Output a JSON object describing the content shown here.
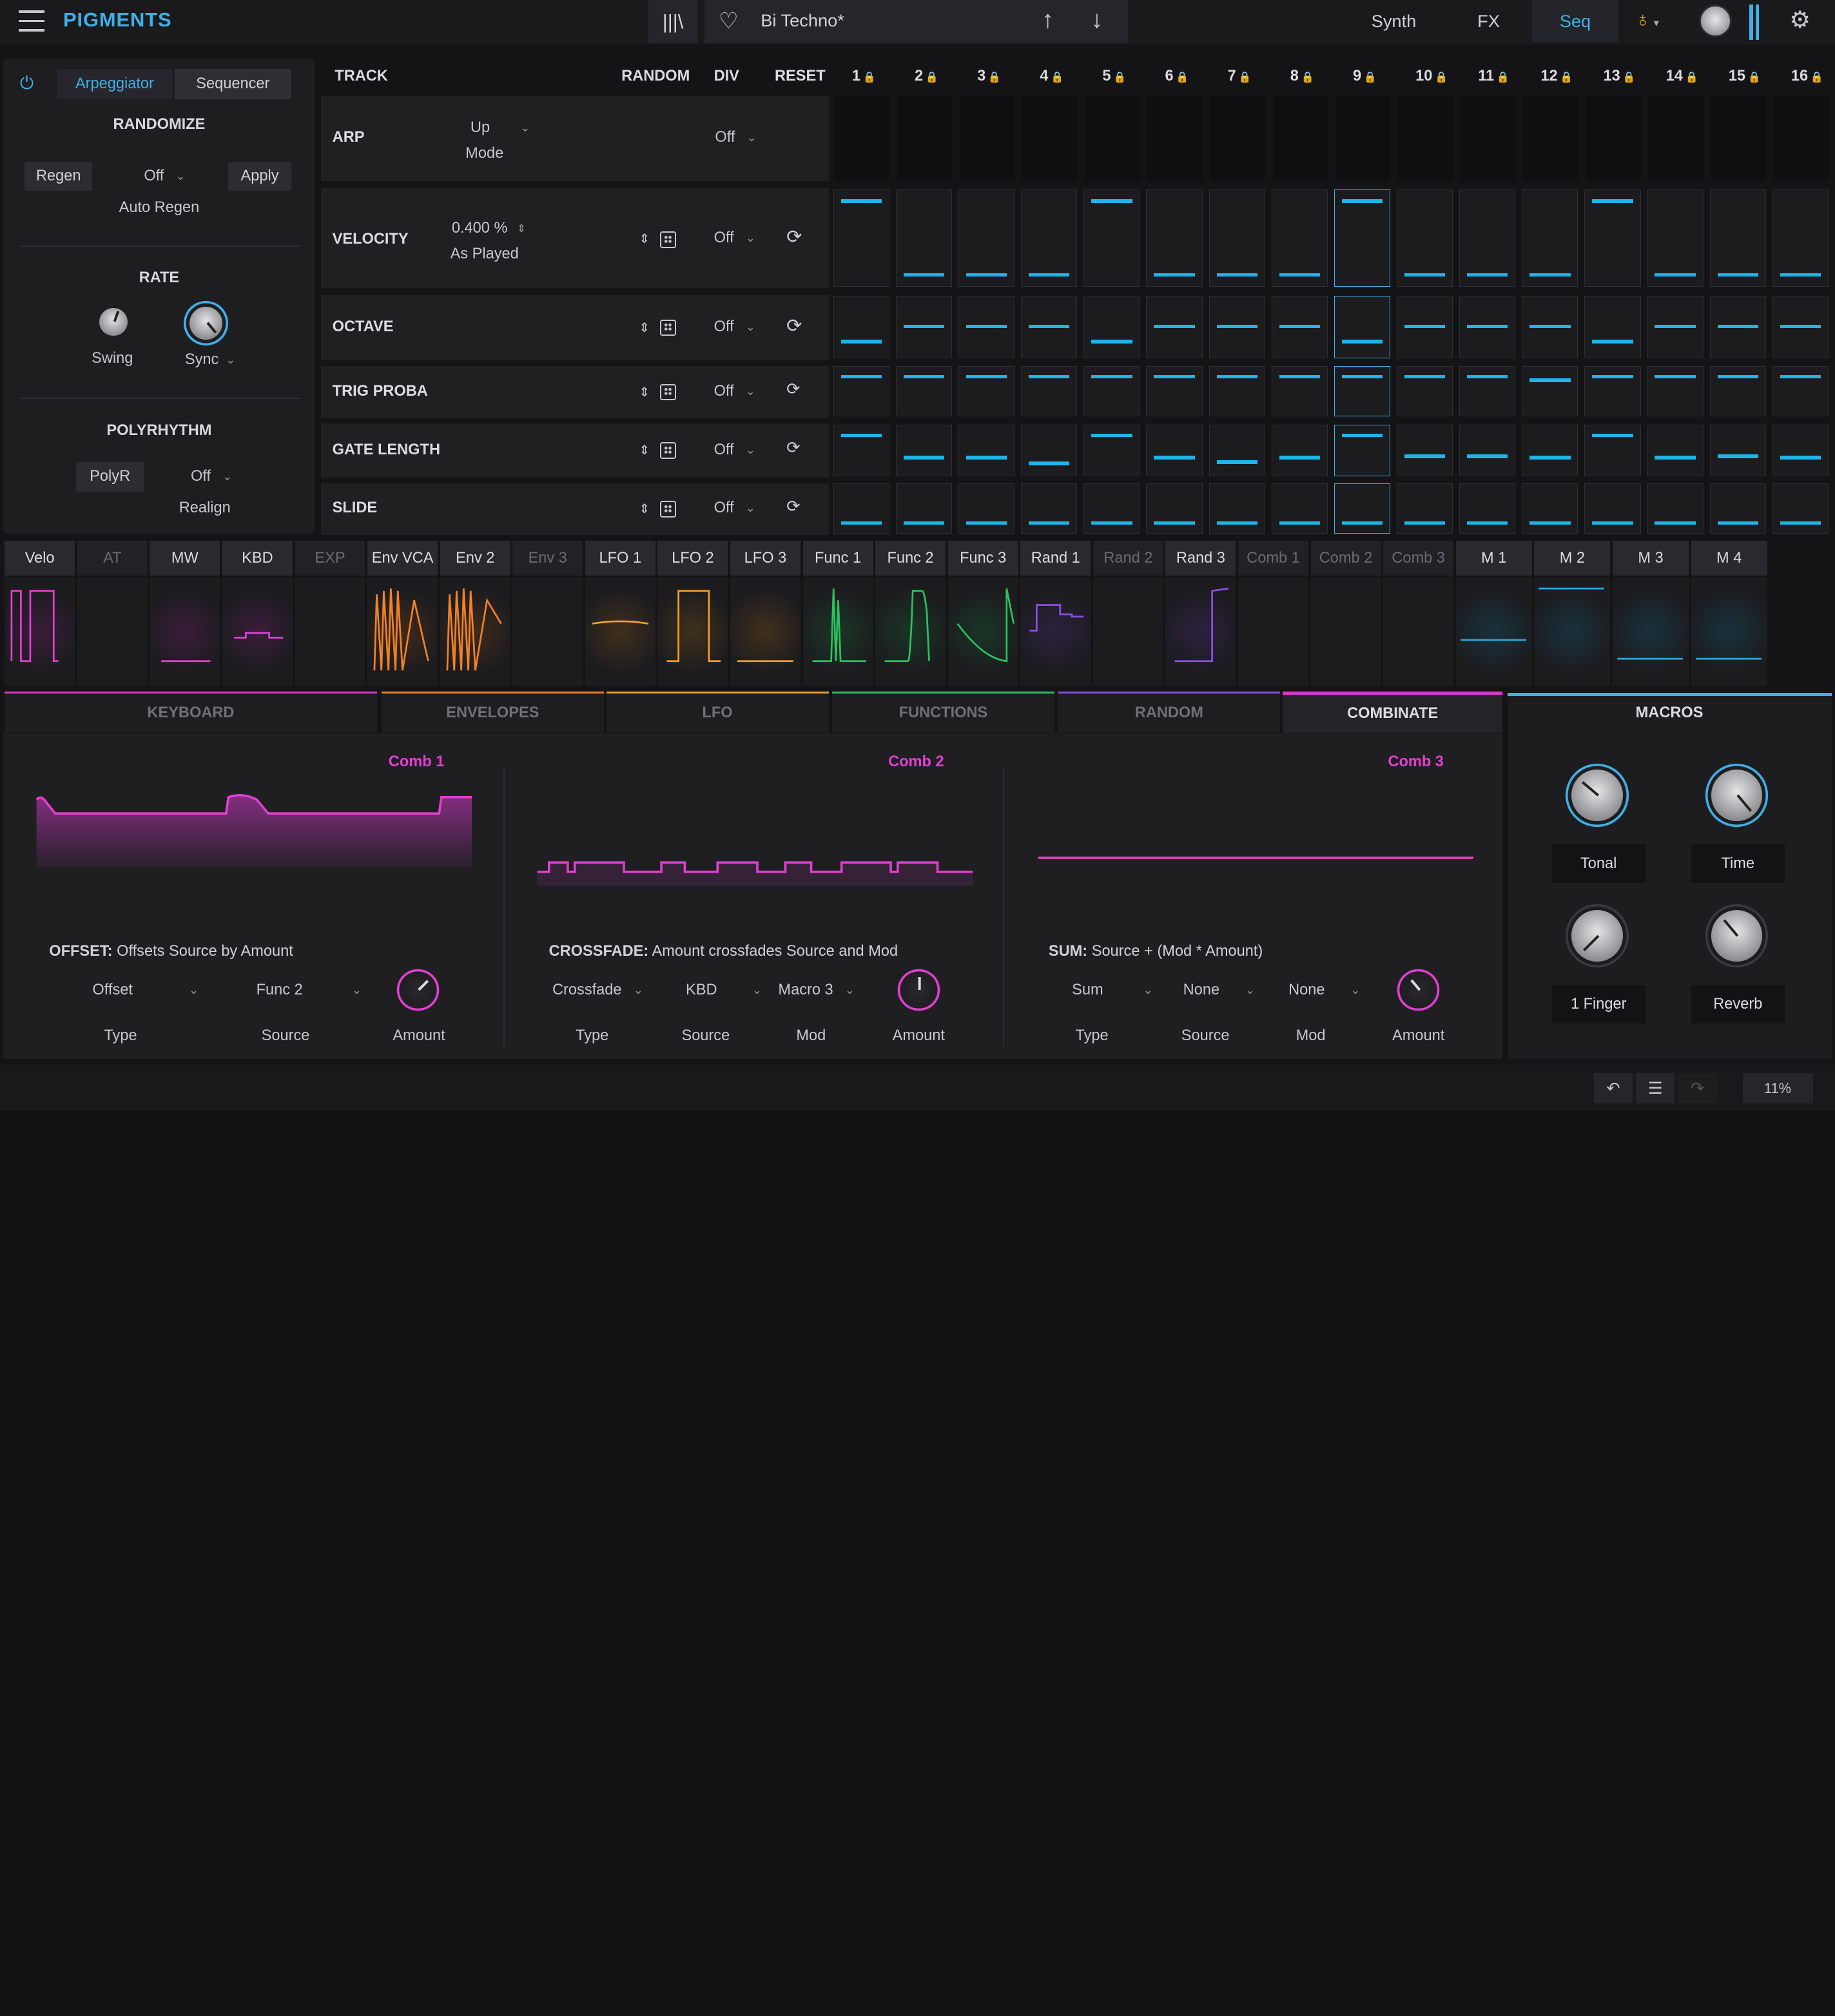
{
  "app": {
    "logo": "PIGMENTS"
  },
  "header": {
    "library_icon": "|||\\",
    "preset_name": "Bi Techno*",
    "tabs": [
      "Synth",
      "FX",
      "Seq"
    ],
    "active_tab": "Seq",
    "accent_color": "#3fb0e6"
  },
  "arp": {
    "mode_tabs": [
      "Arpeggiator",
      "Sequencer"
    ],
    "randomize_title": "RANDOMIZE",
    "regen_label": "Regen",
    "auto_regen_value": "Off",
    "apply_label": "Apply",
    "auto_regen_label": "Auto Regen",
    "rate_title": "RATE",
    "swing_label": "Swing",
    "sync_label": "Sync",
    "polyrhythm_title": "POLYRHYTHM",
    "polyr_label": "PolyR",
    "realign_value": "Off",
    "realign_label": "Realign"
  },
  "sequencer": {
    "headers": {
      "track": "TRACK",
      "random": "RANDOM",
      "div": "DIV",
      "reset": "RESET"
    },
    "steps": [
      "1",
      "2",
      "3",
      "4",
      "5",
      "6",
      "7",
      "8",
      "9",
      "10",
      "11",
      "12",
      "13",
      "14",
      "15",
      "16"
    ],
    "selected_step": 9,
    "arp_row": {
      "name": "ARP",
      "mode_value": "Up",
      "mode_label": "Mode",
      "div": "Off"
    },
    "velocity_row": {
      "name": "VELOCITY",
      "value": "0.400 %",
      "sub": "As Played",
      "div": "Off"
    },
    "rows": [
      {
        "name": "OCTAVE",
        "div": "Off"
      },
      {
        "name": "TRIG PROBA",
        "div": "Off"
      },
      {
        "name": "GATE LENGTH",
        "div": "Off"
      },
      {
        "name": "SLIDE",
        "div": "Off"
      }
    ],
    "velocity_levels": [
      0.95,
      0.05,
      0.05,
      0.05,
      0.95,
      0.05,
      0.05,
      0.05,
      0.95,
      0.05,
      0.05,
      0.05,
      0.95,
      0.05,
      0.05,
      0.05
    ],
    "octave_levels": [
      0.2,
      0.5,
      0.5,
      0.5,
      0.2,
      0.5,
      0.5,
      0.5,
      0.2,
      0.5,
      0.5,
      0.5,
      0.2,
      0.5,
      0.5,
      0.5
    ],
    "trig_levels": [
      0.9,
      0.9,
      0.9,
      0.9,
      0.9,
      0.9,
      0.9,
      0.9,
      0.9,
      0.9,
      0.9,
      0.8,
      0.9,
      0.9,
      0.9,
      0.9
    ],
    "gate_levels": [
      0.9,
      0.3,
      0.3,
      0.15,
      0.9,
      0.3,
      0.2,
      0.3,
      0.9,
      0.35,
      0.35,
      0.3,
      0.9,
      0.3,
      0.35,
      0.3
    ],
    "slide_levels": [
      0.1,
      0.1,
      0.1,
      0.1,
      0.1,
      0.1,
      0.1,
      0.1,
      0.1,
      0.1,
      0.1,
      0.1,
      0.1,
      0.1,
      0.1,
      0.1
    ]
  },
  "mod_sources": [
    {
      "label": "Velo",
      "dim": false,
      "color": "#d83ad0"
    },
    {
      "label": "AT",
      "dim": true,
      "color": "#555"
    },
    {
      "label": "MW",
      "dim": false,
      "color": "#d83ad0"
    },
    {
      "label": "KBD",
      "dim": false,
      "color": "#d83ad0"
    },
    {
      "label": "EXP",
      "dim": true,
      "color": "#555"
    },
    {
      "label": "Env VCA",
      "dim": false,
      "color": "#f0822a"
    },
    {
      "label": "Env 2",
      "dim": false,
      "color": "#f0822a"
    },
    {
      "label": "Env 3",
      "dim": true,
      "color": "#555"
    },
    {
      "label": "LFO 1",
      "dim": false,
      "color": "#f0a030"
    },
    {
      "label": "LFO 2",
      "dim": false,
      "color": "#f0a030"
    },
    {
      "label": "LFO 3",
      "dim": false,
      "color": "#f0a030"
    },
    {
      "label": "Func 1",
      "dim": false,
      "color": "#2ec060"
    },
    {
      "label": "Func 2",
      "dim": false,
      "color": "#2ec060"
    },
    {
      "label": "Func 3",
      "dim": false,
      "color": "#2ec060"
    },
    {
      "label": "Rand 1",
      "dim": false,
      "color": "#8a50e0"
    },
    {
      "label": "Rand 2",
      "dim": true,
      "color": "#555"
    },
    {
      "label": "Rand 3",
      "dim": false,
      "color": "#8a50e0"
    },
    {
      "label": "Comb 1",
      "dim": true,
      "color": "#555"
    },
    {
      "label": "Comb 2",
      "dim": true,
      "color": "#555"
    },
    {
      "label": "Comb 3",
      "dim": true,
      "color": "#555"
    },
    {
      "label": "M 1",
      "dim": false,
      "color": "#2aa8d8"
    },
    {
      "label": "M 2",
      "dim": false,
      "color": "#2aa8d8"
    },
    {
      "label": "M 3",
      "dim": false,
      "color": "#2aa8d8"
    },
    {
      "label": "M 4",
      "dim": false,
      "color": "#2aa8d8"
    }
  ],
  "categories": [
    {
      "label": "KEYBOARD",
      "color": "#d83ad0"
    },
    {
      "label": "ENVELOPES",
      "color": "#f0822a"
    },
    {
      "label": "LFO",
      "color": "#f0a030"
    },
    {
      "label": "FUNCTIONS",
      "color": "#2ec060"
    },
    {
      "label": "RANDOM",
      "color": "#8a50e0"
    },
    {
      "label": "COMBINATE",
      "color": "#d83ad0"
    }
  ],
  "active_category": "COMBINATE",
  "combinators": [
    {
      "title": "Comb 1",
      "desc_key": "OFFSET:",
      "desc": "Offsets Source by Amount",
      "controls": [
        {
          "value": "Offset",
          "label": "Type"
        },
        {
          "value": "Func 2",
          "label": "Source"
        }
      ],
      "amount_label": "Amount"
    },
    {
      "title": "Comb 2",
      "desc_key": "CROSSFADE:",
      "desc": "Amount crossfades Source and Mod",
      "controls": [
        {
          "value": "Crossfade",
          "label": "Type"
        },
        {
          "value": "KBD",
          "label": "Source"
        },
        {
          "value": "Macro 3",
          "label": "Mod"
        }
      ],
      "amount_label": "Amount"
    },
    {
      "title": "Comb 3",
      "desc_key": "SUM:",
      "desc": "Source + (Mod * Amount)",
      "controls": [
        {
          "value": "Sum",
          "label": "Type"
        },
        {
          "value": "None",
          "label": "Source"
        },
        {
          "value": "None",
          "label": "Mod"
        }
      ],
      "amount_label": "Amount"
    }
  ],
  "macros": {
    "title": "MACROS",
    "items": [
      "Tonal",
      "Time",
      "1 Finger",
      "Reverb"
    ]
  },
  "footer": {
    "cpu": "11%"
  }
}
